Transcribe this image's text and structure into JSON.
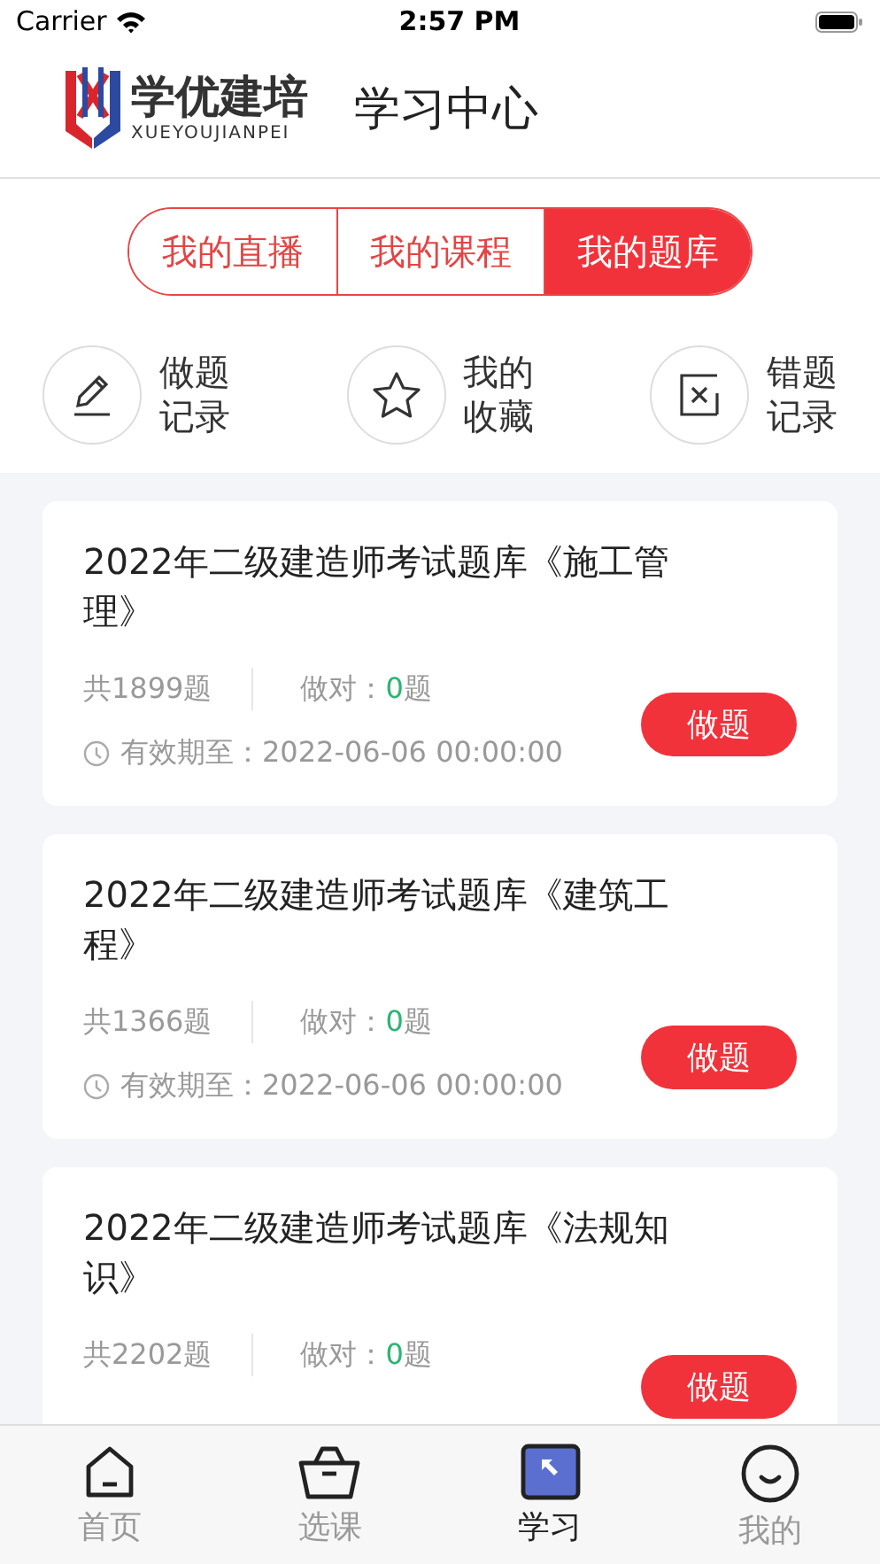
{
  "status_bar": {
    "carrier": "Carrier",
    "time": "2:57 PM"
  },
  "header": {
    "logo_text": "学优建培",
    "logo_subtext": "XUEYOUJIANPEI",
    "title": "学习中心"
  },
  "tabs": [
    {
      "label": "我的直播",
      "selected": false
    },
    {
      "label": "我的课程",
      "selected": false
    },
    {
      "label": "我的题库",
      "selected": true
    }
  ],
  "shortcuts": [
    {
      "kind": "pencil",
      "line1": "做题",
      "line2": "记录"
    },
    {
      "kind": "star",
      "line1": "我的",
      "line2": "收藏"
    },
    {
      "kind": "wrong",
      "line1": "错题",
      "line2": "记录"
    }
  ],
  "cards": [
    {
      "title": "2022年二级建造师考试题库《施工管理》",
      "total": "共1899题",
      "correct_label": "做对：",
      "correct_count": "0",
      "correct_unit": "题",
      "expiry": "有效期至：2022-06-06 00:00:00",
      "button": "做题"
    },
    {
      "title": "2022年二级建造师考试题库《建筑工程》",
      "total": "共1366题",
      "correct_label": "做对：",
      "correct_count": "0",
      "correct_unit": "题",
      "expiry": "有效期至：2022-06-06 00:00:00",
      "button": "做题"
    },
    {
      "title": "2022年二级建造师考试题库《法规知识》",
      "total": "共2202题",
      "correct_label": "做对：",
      "correct_count": "0",
      "correct_unit": "题",
      "button": "做题"
    }
  ],
  "tab_bar": [
    {
      "kind": "home",
      "label": "首页",
      "selected": false
    },
    {
      "kind": "basket",
      "label": "选课",
      "selected": false
    },
    {
      "kind": "study",
      "label": "学习",
      "selected": true
    },
    {
      "kind": "smile",
      "label": "我的",
      "selected": false
    }
  ]
}
